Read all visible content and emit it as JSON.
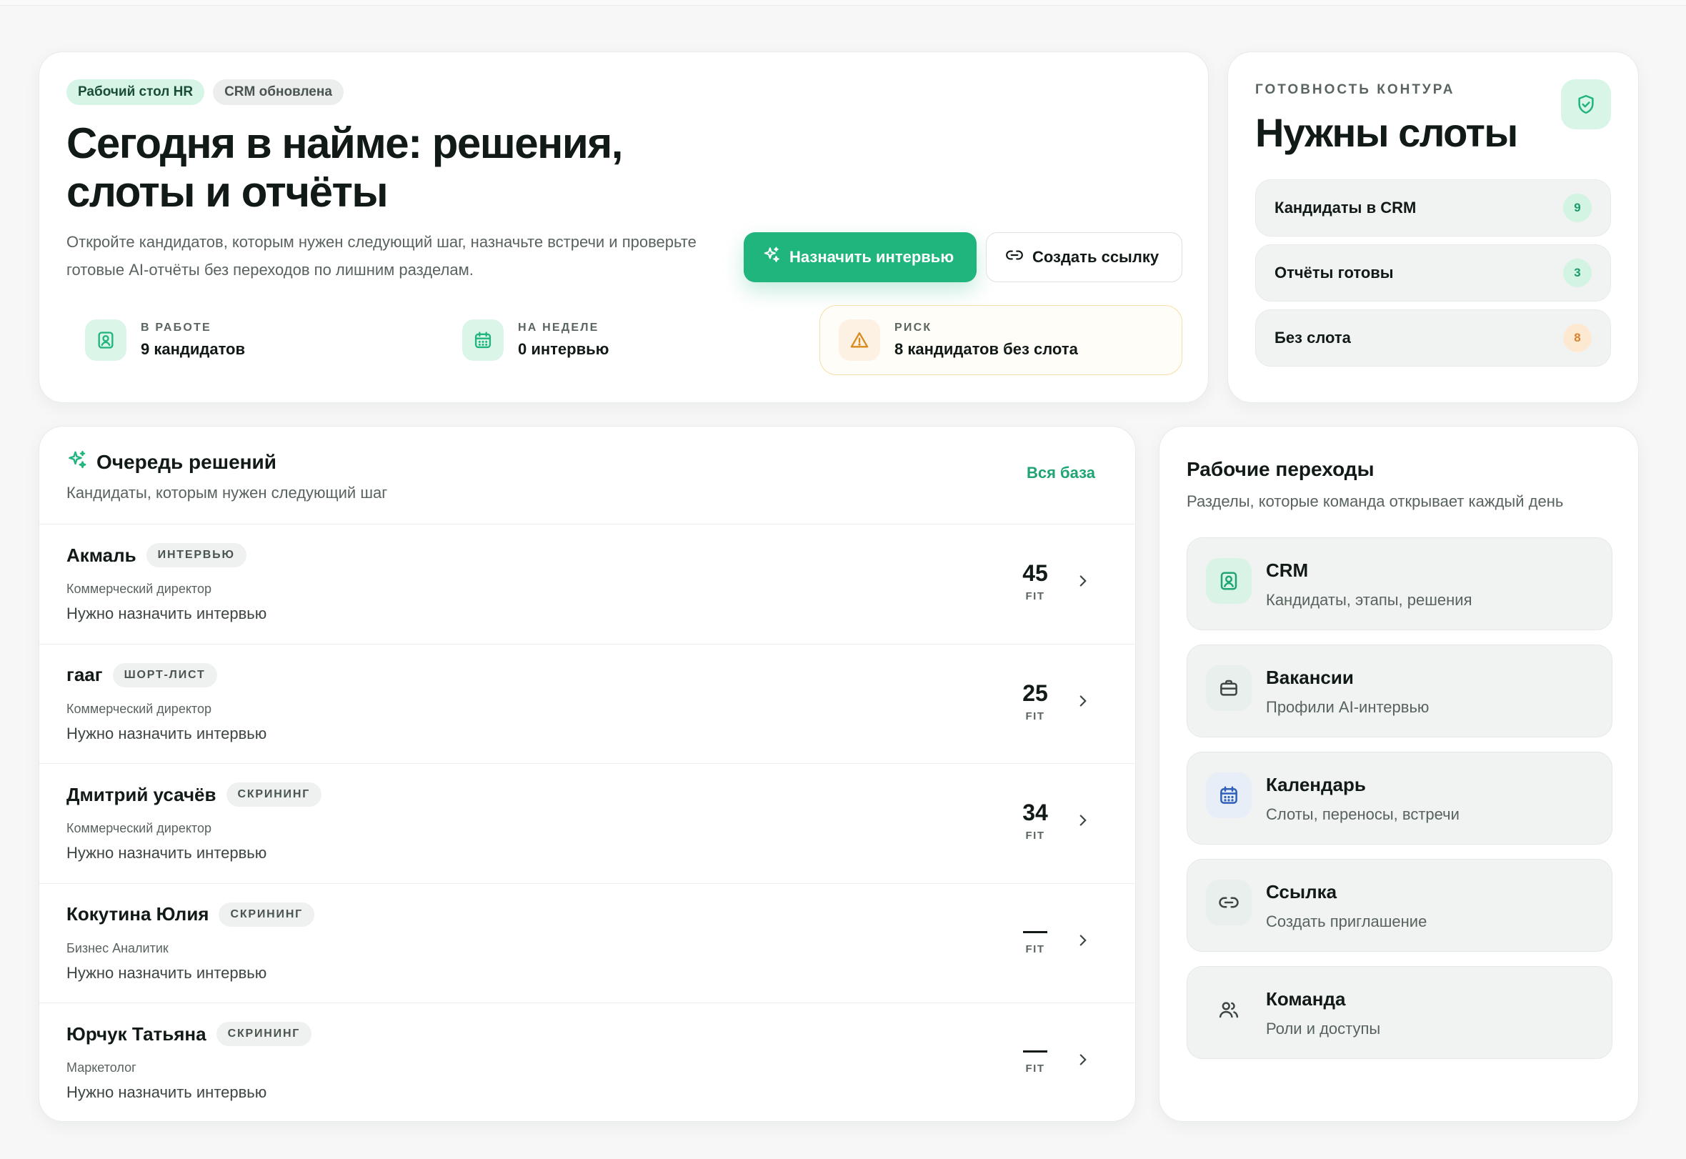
{
  "hero": {
    "chips": [
      "Рабочий стол HR",
      "CRM обновлена"
    ],
    "title_line1": "Сегодня в найме: решения,",
    "title_line2": "слоты и отчёты",
    "description": "Откройте кандидатов, которым нужен следующий шаг, назначьте встречи и проверьте готовые AI-отчёты без переходов по лишним разделам.",
    "primary_button": "Назначить интервью",
    "secondary_button": "Создать ссылку",
    "stats": [
      {
        "label": "В РАБОТЕ",
        "value": "9 кандидатов",
        "icon": "candidate-card-icon"
      },
      {
        "label": "НА НЕДЕЛЕ",
        "value": "0 интервью",
        "icon": "calendar-icon"
      },
      {
        "label": "РИСК",
        "value": "8 кандидатов без слота",
        "icon": "warning-icon"
      }
    ]
  },
  "readiness": {
    "label": "ГОТОВНОСТЬ КОНТУРА",
    "title": "Нужны слоты",
    "icon": "shield-check-icon",
    "items": [
      {
        "label": "Кандидаты в CRM",
        "count": "9"
      },
      {
        "label": "Отчёты готовы",
        "count": "3"
      },
      {
        "label": "Без слота",
        "count": "8"
      }
    ]
  },
  "queue": {
    "title": "Очередь решений",
    "subtitle": "Кандидаты, которым нужен следующий шаг",
    "link": "Вся база",
    "fit_caption": "FIT",
    "rows": [
      {
        "name": "Акмаль",
        "stage": "ИНТЕРВЬЮ",
        "role": "Коммерческий директор",
        "note": "Нужно назначить интервью",
        "fit": "45"
      },
      {
        "name": "гааг",
        "stage": "ШОРТ-ЛИСТ",
        "role": "Коммерческий директор",
        "note": "Нужно назначить интервью",
        "fit": "25"
      },
      {
        "name": "Дмитрий усачёв",
        "stage": "СКРИНИНГ",
        "role": "Коммерческий директор",
        "note": "Нужно назначить интервью",
        "fit": "34"
      },
      {
        "name": "Кокутина Юлия",
        "stage": "СКРИНИНГ",
        "role": "Бизнес Аналитик",
        "note": "Нужно назначить интервью",
        "fit": null
      },
      {
        "name": "Юрчук Татьяна",
        "stage": "СКРИНИНГ",
        "role": "Маркетолог",
        "note": "Нужно назначить интервью",
        "fit": null
      }
    ]
  },
  "links": {
    "title": "Рабочие переходы",
    "subtitle": "Разделы, которые команда открывает каждый день",
    "items": [
      {
        "title": "CRM",
        "desc": "Кандидаты, этапы, решения",
        "icon": "candidate-card-icon"
      },
      {
        "title": "Вакансии",
        "desc": "Профили AI-интервью",
        "icon": "briefcase-icon"
      },
      {
        "title": "Календарь",
        "desc": "Слоты, переносы, встречи",
        "icon": "calendar-icon"
      },
      {
        "title": "Ссылка",
        "desc": "Создать приглашение",
        "icon": "link-icon"
      },
      {
        "title": "Команда",
        "desc": "Роли и доступы",
        "icon": "users-icon"
      }
    ]
  },
  "colors": {
    "accent": "#1fb57c",
    "warning": "#d98a1e",
    "background": "#f6f7f6"
  }
}
